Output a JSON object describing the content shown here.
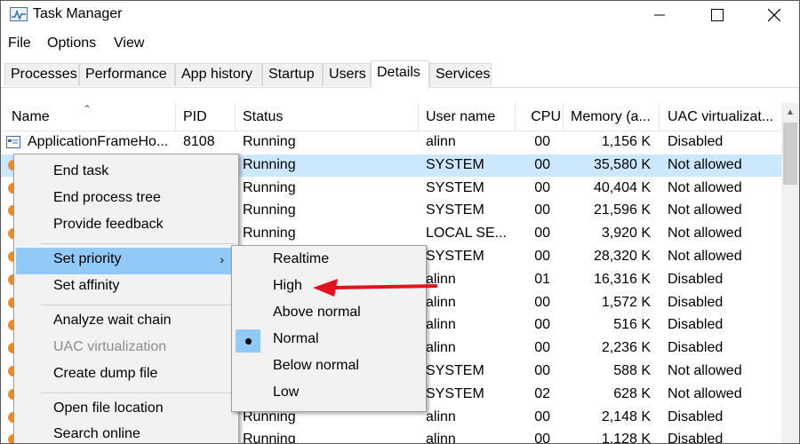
{
  "window": {
    "title": "Task Manager",
    "icon": "task-manager-icon"
  },
  "menubar": [
    "File",
    "Options",
    "View"
  ],
  "tabs": [
    "Processes",
    "Performance",
    "App history",
    "Startup",
    "Users",
    "Details",
    "Services"
  ],
  "active_tab": "Details",
  "columns": [
    "Name",
    "PID",
    "Status",
    "User name",
    "CPU",
    "Memory (a...",
    "UAC virtualizat..."
  ],
  "rows": [
    {
      "name": "ApplicationFrameHo...",
      "pid": "8108",
      "status": "Running",
      "user": "alinn",
      "cpu": "00",
      "mem": "1,156 K",
      "uac": "Disabled"
    },
    {
      "name": "",
      "pid": "",
      "status": "Running",
      "user": "SYSTEM",
      "cpu": "00",
      "mem": "35,580 K",
      "uac": "Not allowed"
    },
    {
      "name": "",
      "pid": "",
      "status": "Running",
      "user": "SYSTEM",
      "cpu": "00",
      "mem": "40,404 K",
      "uac": "Not allowed"
    },
    {
      "name": "",
      "pid": "",
      "status": "Running",
      "user": "SYSTEM",
      "cpu": "00",
      "mem": "21,596 K",
      "uac": "Not allowed"
    },
    {
      "name": "",
      "pid": "",
      "status": "Running",
      "user": "LOCAL SE...",
      "cpu": "00",
      "mem": "3,920 K",
      "uac": "Not allowed"
    },
    {
      "name": "",
      "pid": "",
      "status": "",
      "user": "SYSTEM",
      "cpu": "00",
      "mem": "28,320 K",
      "uac": "Not allowed"
    },
    {
      "name": "",
      "pid": "",
      "status": "",
      "user": "alinn",
      "cpu": "01",
      "mem": "16,316 K",
      "uac": "Disabled"
    },
    {
      "name": "",
      "pid": "",
      "status": "",
      "user": "alinn",
      "cpu": "00",
      "mem": "1,572 K",
      "uac": "Disabled"
    },
    {
      "name": "",
      "pid": "",
      "status": "",
      "user": "alinn",
      "cpu": "00",
      "mem": "516 K",
      "uac": "Disabled"
    },
    {
      "name": "",
      "pid": "",
      "status": "",
      "user": "alinn",
      "cpu": "00",
      "mem": "2,236 K",
      "uac": "Disabled"
    },
    {
      "name": "",
      "pid": "",
      "status": "",
      "user": "SYSTEM",
      "cpu": "00",
      "mem": "588 K",
      "uac": "Not allowed"
    },
    {
      "name": "",
      "pid": "",
      "status": "",
      "user": "SYSTEM",
      "cpu": "02",
      "mem": "628 K",
      "uac": "Not allowed"
    },
    {
      "name": "",
      "pid": "",
      "status": "Running",
      "user": "alinn",
      "cpu": "00",
      "mem": "2,148 K",
      "uac": "Disabled"
    },
    {
      "name": "",
      "pid": "",
      "status": "Running",
      "user": "alinn",
      "cpu": "00",
      "mem": "1,128 K",
      "uac": "Disabled"
    }
  ],
  "context_menu": {
    "items": [
      "End task",
      "End process tree",
      "Provide feedback",
      "Set priority",
      "Set affinity",
      "Analyze wait chain",
      "UAC virtualization",
      "Create dump file",
      "Open file location",
      "Search online"
    ],
    "highlighted": "Set priority",
    "disabled": [
      "UAC virtualization"
    ]
  },
  "priority_submenu": {
    "items": [
      "Realtime",
      "High",
      "Above normal",
      "Normal",
      "Below normal",
      "Low"
    ],
    "checked": "Normal"
  },
  "annotation": {
    "arrow_color": "#e0141e"
  },
  "colors": {
    "selected_row": "#cce8ff",
    "menu_highlight": "#91c9f7",
    "menu_bg": "#f2f2f2"
  }
}
